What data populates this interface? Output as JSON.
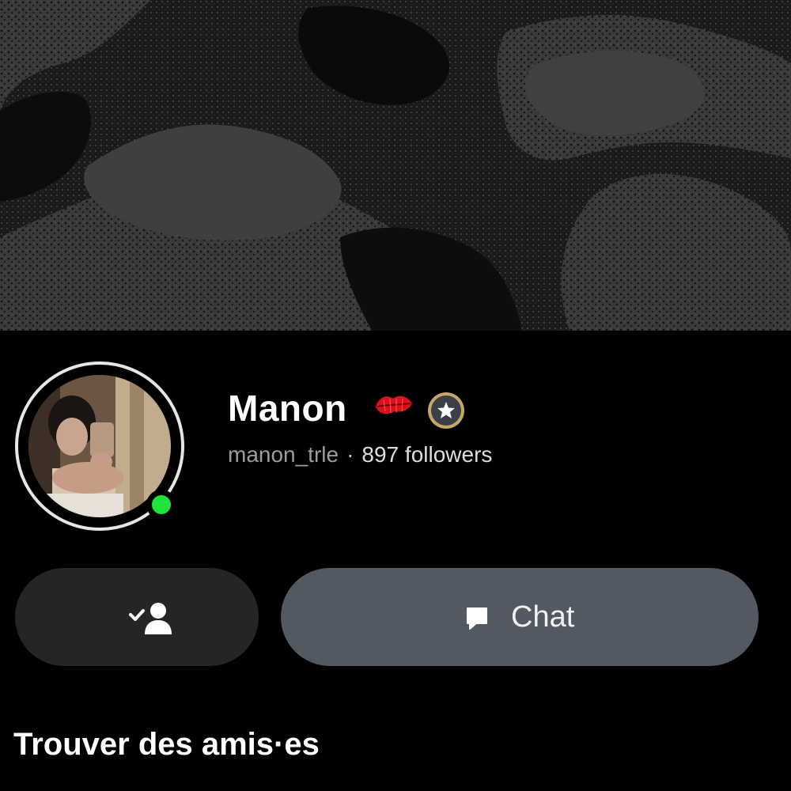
{
  "profile": {
    "display_name": "Manon",
    "name_emoji": "kiss-mark-icon",
    "badge": "star-badge-icon",
    "username": "manon_trle",
    "separator": "·",
    "followers": "897 followers",
    "online": true
  },
  "actions": {
    "added_button_icon": "friend-added-icon",
    "chat_label": "Chat",
    "chat_icon": "chat-bubble-icon"
  },
  "sections": {
    "find_friends_title": "Trouver des amis·es"
  },
  "colors": {
    "background": "#000000",
    "online": "#1ee33a",
    "chat_button": "#535962",
    "added_button": "#242527",
    "kiss": "#d8121c",
    "badge_ring": "#c8a66a"
  }
}
